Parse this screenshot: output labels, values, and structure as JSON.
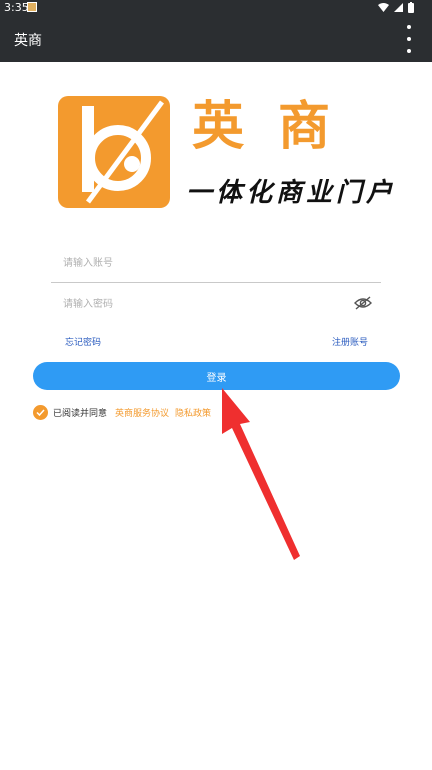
{
  "status_bar": {
    "time": "3:35"
  },
  "app_bar": {
    "title": "英商",
    "more_icon": "more-vertical-icon"
  },
  "brand": {
    "name": "英商",
    "slogan": "一体化商业门户",
    "logo_icon": "brand-logo-icon",
    "accent_color": "#f39a2e"
  },
  "form": {
    "account_placeholder": "请输入账号",
    "password_placeholder": "请输入密码",
    "forgot_label": "忘记密码",
    "register_label": "注册账号",
    "login_label": "登录"
  },
  "agreement": {
    "checked": true,
    "prefix": "已阅读并同意",
    "service_link": "英商服务协议",
    "privacy_link": "隐私政策"
  },
  "colors": {
    "primary": "#2f9bf4",
    "link": "#2a5bbf",
    "bar": "#2b2e31"
  }
}
